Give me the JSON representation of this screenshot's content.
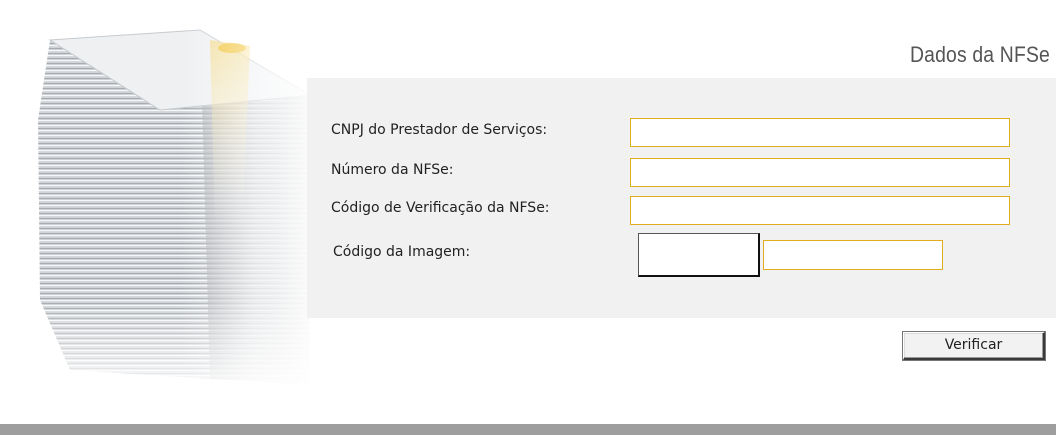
{
  "section": {
    "title": "Dados da NFSe"
  },
  "form": {
    "fields": [
      {
        "label": "CNPJ do Prestador de Serviços:",
        "value": "",
        "placeholder": ""
      },
      {
        "label": "Número da NFSe:",
        "value": "",
        "placeholder": ""
      },
      {
        "label": "Código de Verificação da NFSe:",
        "value": "",
        "placeholder": ""
      }
    ],
    "captcha": {
      "label": "Código da Imagem:",
      "value": "",
      "placeholder": ""
    },
    "submit_label": "Verificar"
  },
  "illustration": {
    "icon": "paper-stack-icon"
  },
  "colors": {
    "input_border": "#e2ac20",
    "panel_background": "#f1f1f1",
    "bottom_bar": "#9e9e9e"
  }
}
